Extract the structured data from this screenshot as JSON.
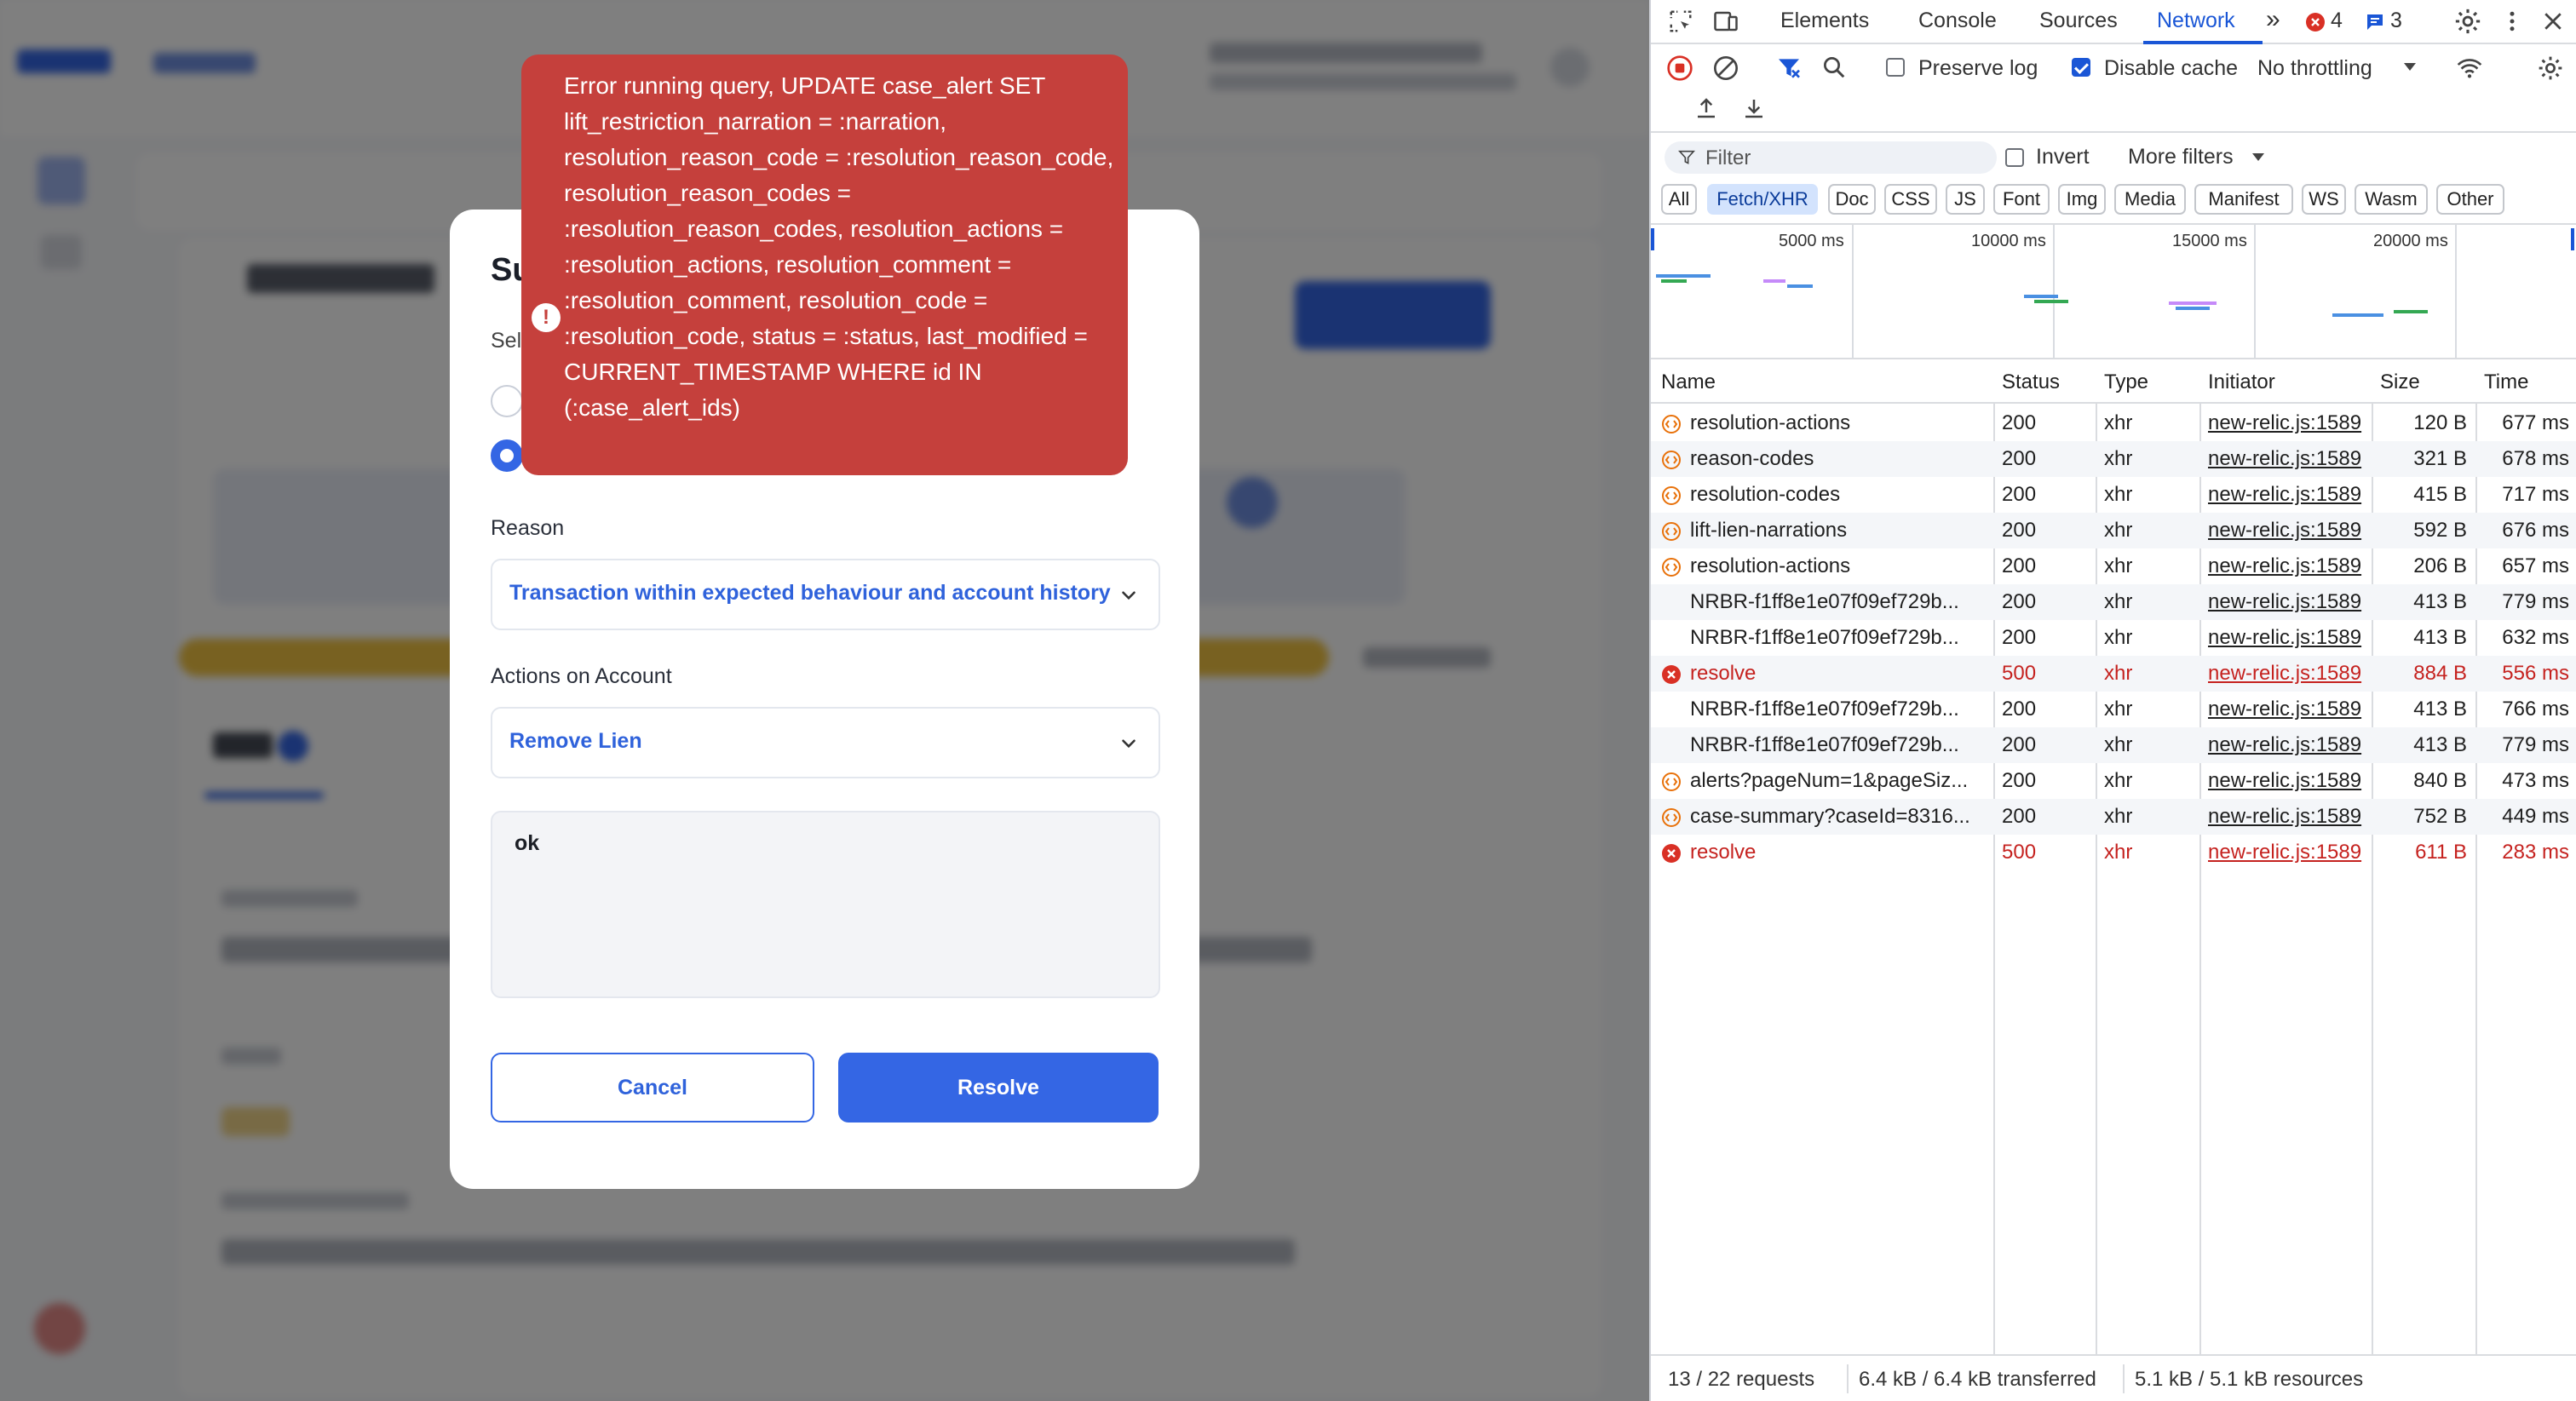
{
  "modal": {
    "title": "Su",
    "subtitle": "Sel",
    "reason_label": "Reason",
    "reason_value": "Transaction within expected behaviour and account history",
    "actions_label": "Actions on Account",
    "actions_value": "Remove Lien",
    "comment_value": "ok",
    "cancel_label": "Cancel",
    "resolve_label": "Resolve",
    "accent_color": "#3466e4"
  },
  "error_toast": {
    "message": "Error running query, UPDATE case_alert SET lift_restriction_narration = :narration, resolution_reason_code = :resolution_reason_code, resolution_reason_codes = :resolution_reason_codes, resolution_actions = :resolution_actions, resolution_comment = :resolution_comment, resolution_code = :resolution_code, status = :status, last_modified = CURRENT_TIMESTAMP WHERE id IN (:case_alert_ids)",
    "icon": "exclamation-circle-icon",
    "color": "#c5403c"
  },
  "devtools": {
    "tabs": [
      "Elements",
      "Console",
      "Sources",
      "Network"
    ],
    "active_tab": "Network",
    "error_count": "4",
    "message_count": "3",
    "toolbar": {
      "preserve_log": "Preserve log",
      "disable_cache": "Disable cache",
      "throttling": "No throttling"
    },
    "filter": {
      "placeholder": "Filter",
      "invert": "Invert",
      "more_filters": "More filters"
    },
    "type_filters": [
      "All",
      "Fetch/XHR",
      "Doc",
      "CSS",
      "JS",
      "Font",
      "Img",
      "Media",
      "Manifest",
      "WS",
      "Wasm",
      "Other"
    ],
    "active_type_filter": "Fetch/XHR",
    "timeline_labels": [
      "5000 ms",
      "10000 ms",
      "15000 ms",
      "20000 ms"
    ],
    "columns": [
      "Name",
      "Status",
      "Type",
      "Initiator",
      "Size",
      "Time"
    ],
    "requests": [
      {
        "name": "resolution-actions",
        "status": "200",
        "type": "xhr",
        "initiator": "new-relic.js:1589",
        "size": "120 B",
        "time": "677 ms",
        "icon": "fetch-icon",
        "error": false
      },
      {
        "name": "reason-codes",
        "status": "200",
        "type": "xhr",
        "initiator": "new-relic.js:1589",
        "size": "321 B",
        "time": "678 ms",
        "icon": "fetch-icon",
        "error": false
      },
      {
        "name": "resolution-codes",
        "status": "200",
        "type": "xhr",
        "initiator": "new-relic.js:1589",
        "size": "415 B",
        "time": "717 ms",
        "icon": "fetch-icon",
        "error": false
      },
      {
        "name": "lift-lien-narrations",
        "status": "200",
        "type": "xhr",
        "initiator": "new-relic.js:1589",
        "size": "592 B",
        "time": "676 ms",
        "icon": "fetch-icon",
        "error": false
      },
      {
        "name": "resolution-actions",
        "status": "200",
        "type": "xhr",
        "initiator": "new-relic.js:1589",
        "size": "206 B",
        "time": "657 ms",
        "icon": "fetch-icon",
        "error": false
      },
      {
        "name": "NRBR-f1ff8e1e07f09ef729b...",
        "status": "200",
        "type": "xhr",
        "initiator": "new-relic.js:1589",
        "size": "413 B",
        "time": "779 ms",
        "icon": "",
        "error": false
      },
      {
        "name": "NRBR-f1ff8e1e07f09ef729b...",
        "status": "200",
        "type": "xhr",
        "initiator": "new-relic.js:1589",
        "size": "413 B",
        "time": "632 ms",
        "icon": "",
        "error": false
      },
      {
        "name": "resolve",
        "status": "500",
        "type": "xhr",
        "initiator": "new-relic.js:1589",
        "size": "884 B",
        "time": "556 ms",
        "icon": "error-icon",
        "error": true
      },
      {
        "name": "NRBR-f1ff8e1e07f09ef729b...",
        "status": "200",
        "type": "xhr",
        "initiator": "new-relic.js:1589",
        "size": "413 B",
        "time": "766 ms",
        "icon": "",
        "error": false
      },
      {
        "name": "NRBR-f1ff8e1e07f09ef729b...",
        "status": "200",
        "type": "xhr",
        "initiator": "new-relic.js:1589",
        "size": "413 B",
        "time": "779 ms",
        "icon": "",
        "error": false
      },
      {
        "name": "alerts?pageNum=1&pageSiz...",
        "status": "200",
        "type": "xhr",
        "initiator": "new-relic.js:1589",
        "size": "840 B",
        "time": "473 ms",
        "icon": "fetch-icon",
        "error": false
      },
      {
        "name": "case-summary?caseId=8316...",
        "status": "200",
        "type": "xhr",
        "initiator": "new-relic.js:1589",
        "size": "752 B",
        "time": "449 ms",
        "icon": "fetch-icon",
        "error": false
      },
      {
        "name": "resolve",
        "status": "500",
        "type": "xhr",
        "initiator": "new-relic.js:1589",
        "size": "611 B",
        "time": "283 ms",
        "icon": "error-icon",
        "error": true
      }
    ],
    "status_bar": {
      "requests": "13 / 22 requests",
      "transferred": "6.4 kB / 6.4 kB transferred",
      "resources": "5.1 kB / 5.1 kB resources"
    }
  }
}
